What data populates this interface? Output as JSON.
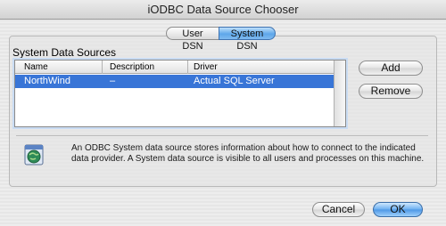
{
  "window": {
    "title": "iODBC Data Source Chooser"
  },
  "tabs": [
    {
      "label": "User DSN",
      "selected": false
    },
    {
      "label": "System DSN",
      "selected": true
    }
  ],
  "group": {
    "title": "System Data Sources"
  },
  "table": {
    "columns": [
      "Name",
      "Description",
      "Driver"
    ],
    "rows": [
      {
        "name": "NorthWind",
        "description": "–",
        "driver": "Actual SQL Server",
        "selected": true
      }
    ]
  },
  "side_buttons": {
    "add": "Add",
    "remove": "Remove"
  },
  "info": {
    "icon": "globe-database-icon",
    "text": "An ODBC System data source stores information about how to connect to the indicated data provider. A System data source is visible to all users and processes on this machine."
  },
  "footer": {
    "cancel": "Cancel",
    "ok": "OK"
  },
  "colors": {
    "selection": "#3875d7",
    "default_button": "#4d97e6"
  }
}
